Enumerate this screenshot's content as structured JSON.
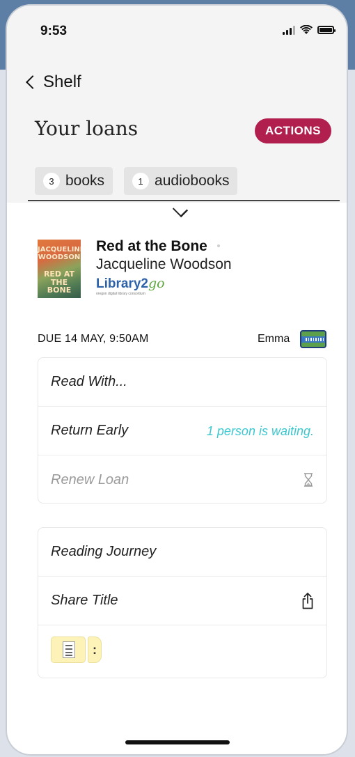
{
  "status_bar": {
    "time": "9:53",
    "icons": [
      "signal-icon",
      "wifi-icon",
      "battery-icon"
    ]
  },
  "nav": {
    "back_label": "Shelf"
  },
  "header": {
    "title": "Your loans",
    "actions_label": "ACTIONS"
  },
  "filters": [
    {
      "count": "3",
      "label": "books"
    },
    {
      "count": "1",
      "label": "audiobooks"
    }
  ],
  "book": {
    "title": "Red at the Bone",
    "author": "Jacqueline Woodson",
    "cover": {
      "author_text": "JACQUELINE WOODSON",
      "title_text": "RED AT THE BONE"
    },
    "library": {
      "name_main": "Library2",
      "name_go": "go",
      "subtitle": "oregon digital library consortium"
    }
  },
  "loan": {
    "due": "DUE 14 MAY, 9:50AM",
    "card_name": "Emma"
  },
  "menu_primary": [
    {
      "label": "Read With..."
    },
    {
      "label": "Return Early",
      "note": "1 person is waiting."
    },
    {
      "label": "Renew Loan",
      "disabled": true
    }
  ],
  "menu_secondary": [
    {
      "label": "Reading Journey"
    },
    {
      "label": "Share Title"
    }
  ],
  "colors": {
    "accent": "#b01f4e",
    "waiting": "#3cc7cf",
    "library_blue": "#2e62a8",
    "library_green": "#5ea53f"
  }
}
